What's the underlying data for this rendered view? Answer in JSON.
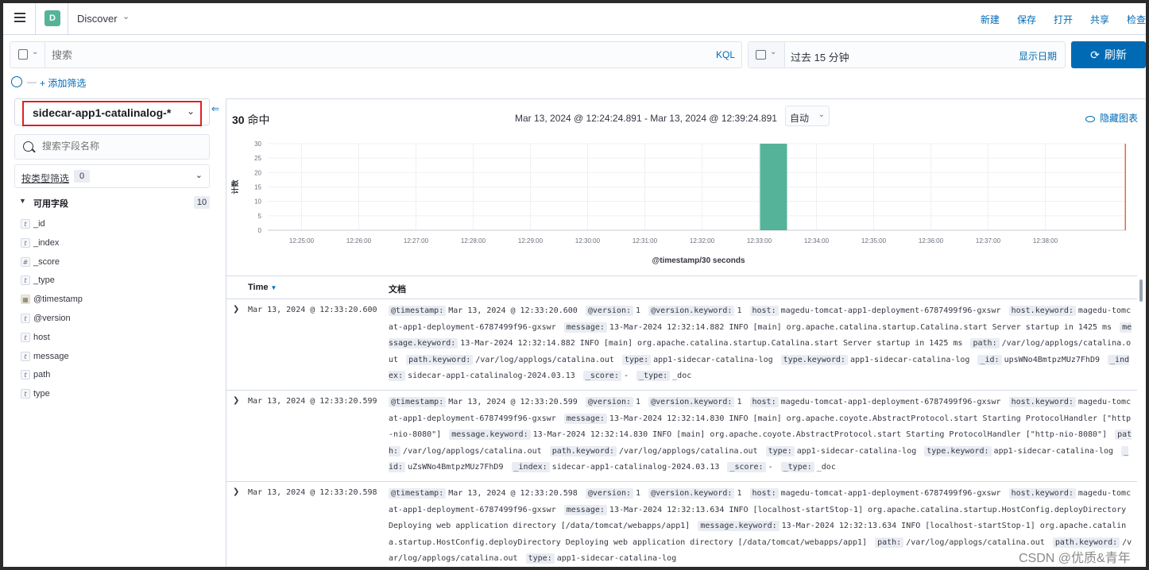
{
  "header": {
    "app_badge": "D",
    "app_title": "Discover",
    "actions": [
      "新建",
      "保存",
      "打开",
      "共享",
      "检查"
    ]
  },
  "query": {
    "placeholder": "搜索",
    "language": "KQL"
  },
  "time": {
    "range_label": "过去 15 分钟",
    "show_dates": "显示日期",
    "refresh_label": "刷新"
  },
  "filters": {
    "add_label": "+ 添加筛选"
  },
  "sidebar": {
    "index_pattern": "sidecar-app1-catalinalog-*",
    "field_search_placeholder": "搜索字段名称",
    "type_filter_label": "按类型筛选",
    "type_filter_count": "0",
    "available_label": "可用字段",
    "available_count": "10",
    "fields": [
      {
        "type": "t",
        "name": "_id"
      },
      {
        "type": "t",
        "name": "_index"
      },
      {
        "type": "#",
        "name": "_score"
      },
      {
        "type": "t",
        "name": "_type"
      },
      {
        "type": "date",
        "name": "@timestamp"
      },
      {
        "type": "t",
        "name": "@version"
      },
      {
        "type": "t",
        "name": "host"
      },
      {
        "type": "t",
        "name": "message"
      },
      {
        "type": "t",
        "name": "path"
      },
      {
        "type": "t",
        "name": "type"
      }
    ]
  },
  "main": {
    "hits_count": "30",
    "hits_label": "命中",
    "time_range": "Mar 13, 2024 @ 12:24:24.891 - Mar 13, 2024 @ 12:39:24.891",
    "interval": "自动",
    "hide_chart": "隐藏图表",
    "col_time": "Time",
    "col_doc": "文档"
  },
  "chart_data": {
    "type": "bar",
    "ylabel": "计数",
    "xlabel": "@timestamp/30 seconds",
    "ylim": [
      0,
      30
    ],
    "yticks": [
      0,
      5,
      10,
      15,
      20,
      25,
      30
    ],
    "x_range_minutes": [
      24.41,
      39.41
    ],
    "xticks": [
      "12:25:00",
      "12:26:00",
      "12:27:00",
      "12:28:00",
      "12:29:00",
      "12:30:00",
      "12:31:00",
      "12:32:00",
      "12:33:00",
      "12:34:00",
      "12:35:00",
      "12:36:00",
      "12:37:00",
      "12:38:00"
    ],
    "bars": [
      {
        "start": "12:33:00",
        "end": "12:33:30",
        "value": 30
      }
    ],
    "now_marker": "12:39:24",
    "bar_color": "#54b399",
    "marker_color": "#e7664c"
  },
  "rows": [
    {
      "time": "Mar 13, 2024 @ 12:33:20.600",
      "fields": [
        {
          "k": "@timestamp:",
          "v": "Mar 13, 2024 @ 12:33:20.600"
        },
        {
          "k": "@version:",
          "v": "1"
        },
        {
          "k": "@version.keyword:",
          "v": "1"
        },
        {
          "k": "host:",
          "v": "magedu-tomcat-app1-deployment-6787499f96-gxswr"
        },
        {
          "k": "host.keyword:",
          "v": "magedu-tomcat-app1-deployment-6787499f96-gxswr"
        },
        {
          "k": "message:",
          "v": "13-Mar-2024 12:32:14.882 INFO [main] org.apache.catalina.startup.Catalina.start Server startup in 1425 ms"
        },
        {
          "k": "message.keyword:",
          "v": "13-Mar-2024 12:32:14.882 INFO [main] org.apache.catalina.startup.Catalina.start Server startup in 1425 ms"
        },
        {
          "k": "path:",
          "v": "/var/log/applogs/catalina.out"
        },
        {
          "k": "path.keyword:",
          "v": "/var/log/applogs/catalina.out"
        },
        {
          "k": "type:",
          "v": "app1-sidecar-catalina-log"
        },
        {
          "k": "type.keyword:",
          "v": "app1-sidecar-catalina-log"
        },
        {
          "k": "_id:",
          "v": "upsWNo4BmtpzMUz7FhD9"
        },
        {
          "k": "_index:",
          "v": "sidecar-app1-catalinalog-2024.03.13"
        },
        {
          "k": "_score:",
          "v": "-"
        },
        {
          "k": "_type:",
          "v": "_doc"
        }
      ]
    },
    {
      "time": "Mar 13, 2024 @ 12:33:20.599",
      "fields": [
        {
          "k": "@timestamp:",
          "v": "Mar 13, 2024 @ 12:33:20.599"
        },
        {
          "k": "@version:",
          "v": "1"
        },
        {
          "k": "@version.keyword:",
          "v": "1"
        },
        {
          "k": "host:",
          "v": "magedu-tomcat-app1-deployment-6787499f96-gxswr"
        },
        {
          "k": "host.keyword:",
          "v": "magedu-tomcat-app1-deployment-6787499f96-gxswr"
        },
        {
          "k": "message:",
          "v": "13-Mar-2024 12:32:14.830 INFO [main] org.apache.coyote.AbstractProtocol.start Starting ProtocolHandler [\"http-nio-8080\"]"
        },
        {
          "k": "message.keyword:",
          "v": "13-Mar-2024 12:32:14.830 INFO [main] org.apache.coyote.AbstractProtocol.start Starting ProtocolHandler [\"http-nio-8080\"]"
        },
        {
          "k": "path:",
          "v": "/var/log/applogs/catalina.out"
        },
        {
          "k": "path.keyword:",
          "v": "/var/log/applogs/catalina.out"
        },
        {
          "k": "type:",
          "v": "app1-sidecar-catalina-log"
        },
        {
          "k": "type.keyword:",
          "v": "app1-sidecar-catalina-log"
        },
        {
          "k": "_id:",
          "v": "uZsWNo4BmtpzMUz7FhD9"
        },
        {
          "k": "_index:",
          "v": "sidecar-app1-catalinalog-2024.03.13"
        },
        {
          "k": "_score:",
          "v": "-"
        },
        {
          "k": "_type:",
          "v": "_doc"
        }
      ]
    },
    {
      "time": "Mar 13, 2024 @ 12:33:20.598",
      "fields": [
        {
          "k": "@timestamp:",
          "v": "Mar 13, 2024 @ 12:33:20.598"
        },
        {
          "k": "@version:",
          "v": "1"
        },
        {
          "k": "@version.keyword:",
          "v": "1"
        },
        {
          "k": "host:",
          "v": "magedu-tomcat-app1-deployment-6787499f96-gxswr"
        },
        {
          "k": "host.keyword:",
          "v": "magedu-tomcat-app1-deployment-6787499f96-gxswr"
        },
        {
          "k": "message:",
          "v": "13-Mar-2024 12:32:13.634 INFO [localhost-startStop-1] org.apache.catalina.startup.HostConfig.deployDirectory Deploying web application directory [/data/tomcat/webapps/app1]"
        },
        {
          "k": "message.keyword:",
          "v": "13-Mar-2024 12:32:13.634 INFO [localhost-startStop-1] org.apache.catalina.startup.HostConfig.deployDirectory Deploying web application directory [/data/tomcat/webapps/app1]"
        },
        {
          "k": "path:",
          "v": "/var/log/applogs/catalina.out"
        },
        {
          "k": "path.keyword:",
          "v": "/var/log/applogs/catalina.out"
        },
        {
          "k": "type:",
          "v": "app1-sidecar-catalina-log"
        }
      ]
    }
  ],
  "watermark": "CSDN @优质&青年"
}
